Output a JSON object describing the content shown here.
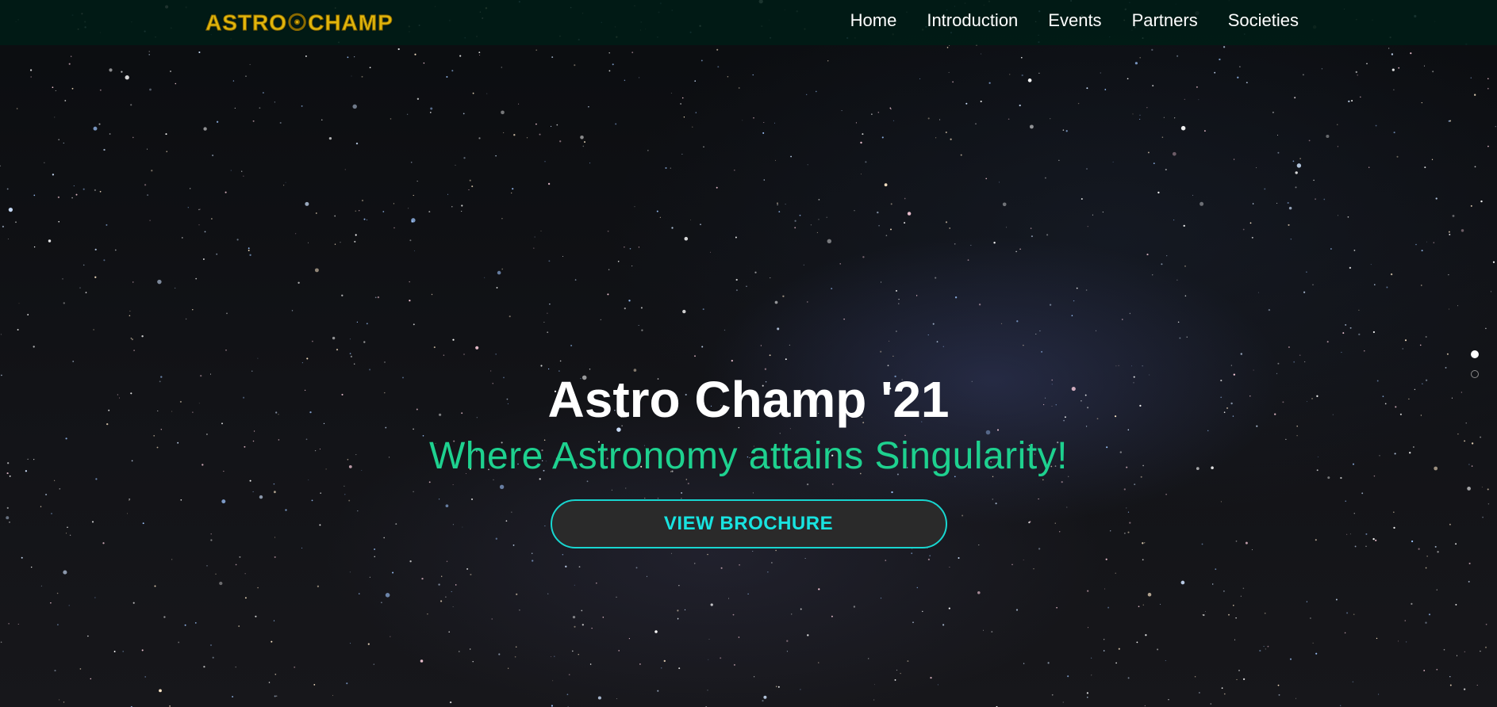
{
  "logo": {
    "text": "ASTRO☉CHAMP",
    "color": "#e2b60c"
  },
  "nav": {
    "items": [
      {
        "label": "Home"
      },
      {
        "label": "Introduction"
      },
      {
        "label": "Events"
      },
      {
        "label": "Partners"
      },
      {
        "label": "Societies"
      }
    ],
    "background": "#001c16"
  },
  "hero": {
    "title": "Astro Champ '21",
    "subtitle": "Where Astronomy attains Singularity!",
    "subtitle_color": "#1ed18f",
    "cta_label": "VIEW BROCHURE",
    "cta_color": "#18e3e0"
  },
  "slider": {
    "slide_count": 2,
    "active_index": 0
  }
}
